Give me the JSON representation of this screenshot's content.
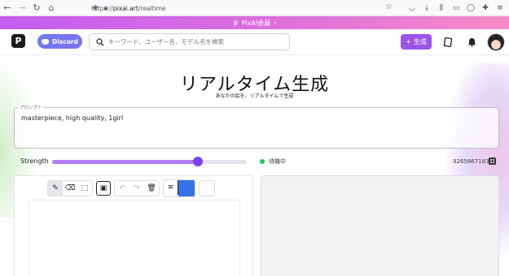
{
  "browser": {
    "url_scheme": "https://",
    "url_host": "pixai.art",
    "url_path": "/realtime"
  },
  "promo": {
    "label": "PixAI会員",
    "chevron": "›"
  },
  "header": {
    "logo_letter": "P",
    "discord_label": "Discord",
    "search_placeholder": "キーワード、ユーザー名、モデル名を検索",
    "generate_label": "生成",
    "generate_icon": "+"
  },
  "main": {
    "title": "リアルタイム生成",
    "subtitle": "あなたの絵を、リアルタイムで生成",
    "prompt_label": "プロンプト",
    "prompt_value": "masterpiece, high quality, 1girl",
    "strength_label": "Strength",
    "strength_value": 0.75,
    "status_text": "待機中",
    "seed": "9265867183"
  },
  "colors": {
    "accent": "#9a55e8",
    "slider_thumb": "#7b43e8",
    "status": "#22c55e",
    "brush_color": "#3574e8"
  },
  "icons": {
    "toolbar": [
      "pencil-icon",
      "eraser-icon",
      "select-icon",
      "image-icon",
      "undo-icon",
      "redo-icon",
      "trash-icon",
      "line-width-icon"
    ]
  }
}
